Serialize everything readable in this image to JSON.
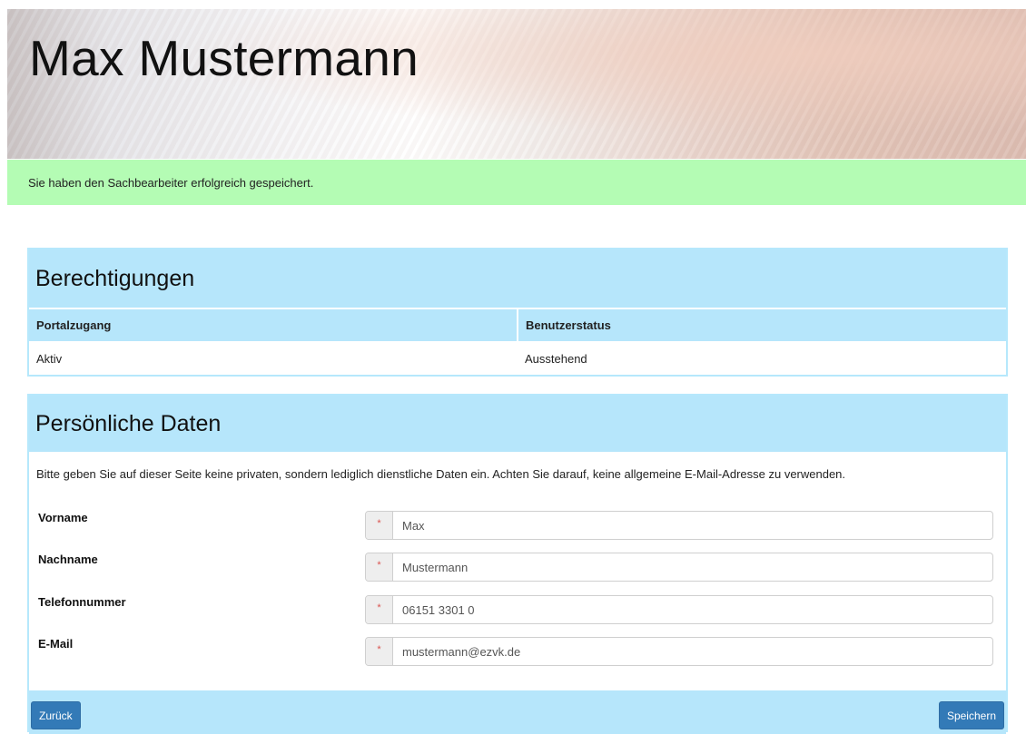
{
  "header": {
    "title": "Max Mustermann"
  },
  "alert": {
    "message": "Sie haben den Sachbearbeiter erfolgreich gespeichert.",
    "color": "#b4fcb4"
  },
  "permissions": {
    "title": "Berechtigungen",
    "columns": [
      "Portalzugang",
      "Benutzerstatus"
    ],
    "rows": [
      [
        "Aktiv",
        "Ausstehend"
      ]
    ]
  },
  "personal": {
    "title": "Persönliche Daten",
    "note": "Bitte geben Sie auf dieser Seite keine privaten, sondern lediglich dienstliche Daten ein. Achten Sie darauf, keine allgemeine E-Mail-Adresse zu verwenden.",
    "required_mark": "*",
    "fields": [
      {
        "label": "Vorname",
        "value": "Max"
      },
      {
        "label": "Nachname",
        "value": "Mustermann"
      },
      {
        "label": "Telefonnummer",
        "value": "06151 3301 0"
      },
      {
        "label": "E-Mail",
        "value": "mustermann@ezvk.de"
      }
    ]
  },
  "actions": {
    "back_label": "Zurück",
    "save_label": "Speichern"
  },
  "colors": {
    "panel": "#b6e6fb",
    "button": "#337ab7",
    "required": "#d9534f"
  }
}
